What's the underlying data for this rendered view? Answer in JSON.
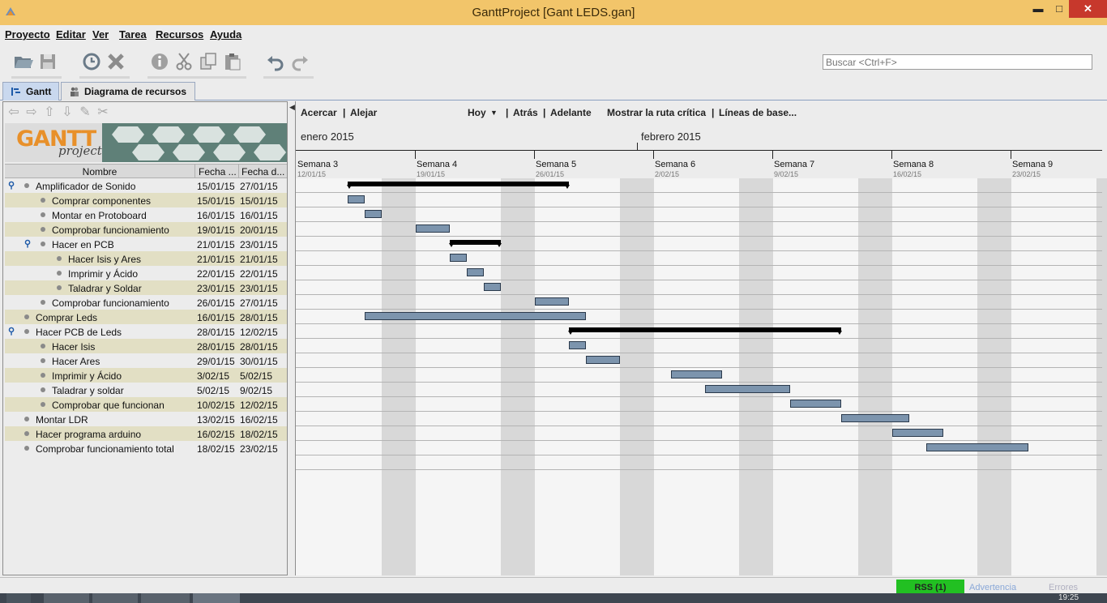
{
  "window": {
    "title": "GanttProject [Gant LEDS.gan]",
    "minimize": "▬",
    "maximize": "□",
    "close": "✕"
  },
  "menu": [
    "Proyecto",
    "Editar",
    "Ver",
    "Tarea",
    "Recursos",
    "Ayuda"
  ],
  "toolbar": {
    "icons": [
      "open-folder-icon",
      "save-icon",
      "history-icon",
      "delete-icon",
      "info-icon",
      "cut-icon",
      "copy-icon",
      "paste-icon",
      "undo-icon",
      "redo-icon"
    ],
    "search_placeholder": "Buscar <Ctrl+F>"
  },
  "tabs": {
    "gantt": "Gantt",
    "resources": "Diagrama de recursos"
  },
  "logo": {
    "text": "GANTT",
    "sub": "project"
  },
  "table": {
    "headers": {
      "name": "Nombre",
      "start": "Fecha ...",
      "end": "Fecha d..."
    },
    "rows": [
      {
        "name": "Amplificador de Sonido",
        "start": "15/01/15",
        "end": "27/01/15"
      },
      {
        "name": "Comprar componentes",
        "start": "15/01/15",
        "end": "15/01/15"
      },
      {
        "name": "Montar en Protoboard",
        "start": "16/01/15",
        "end": "16/01/15"
      },
      {
        "name": "Comprobar funcionamiento",
        "start": "19/01/15",
        "end": "20/01/15"
      },
      {
        "name": "Hacer en PCB",
        "start": "21/01/15",
        "end": "23/01/15"
      },
      {
        "name": "Hacer Isis y Ares",
        "start": "21/01/15",
        "end": "21/01/15"
      },
      {
        "name": "Imprimir y Ácido",
        "start": "22/01/15",
        "end": "22/01/15"
      },
      {
        "name": "Taladrar y Soldar",
        "start": "23/01/15",
        "end": "23/01/15"
      },
      {
        "name": "Comprobar funcionamiento",
        "start": "26/01/15",
        "end": "27/01/15"
      },
      {
        "name": "Comprar Leds",
        "start": "16/01/15",
        "end": "28/01/15"
      },
      {
        "name": "Hacer PCB de Leds",
        "start": "28/01/15",
        "end": "12/02/15"
      },
      {
        "name": "Hacer Isis",
        "start": "28/01/15",
        "end": "28/01/15"
      },
      {
        "name": "Hacer Ares",
        "start": "29/01/15",
        "end": "30/01/15"
      },
      {
        "name": "Imprimir y Ácido",
        "start": "3/02/15",
        "end": "5/02/15"
      },
      {
        "name": "Taladrar y soldar",
        "start": "5/02/15",
        "end": "9/02/15"
      },
      {
        "name": "Comprobar que funcionan",
        "start": "10/02/15",
        "end": "12/02/15"
      },
      {
        "name": "Montar LDR",
        "start": "13/02/15",
        "end": "16/02/15"
      },
      {
        "name": "Hacer programa arduino",
        "start": "16/02/15",
        "end": "18/02/15"
      },
      {
        "name": "Comprobar funcionamiento total",
        "start": "18/02/15",
        "end": "23/02/15"
      }
    ]
  },
  "chart_nav": {
    "zoom_in": "Acercar",
    "zoom_out": "Alejar",
    "today": "Hoy",
    "back": "Atrás",
    "forward": "Adelante",
    "critical_path": "Mostrar la ruta crítica",
    "baselines": "Líneas de base...",
    "sep": "|"
  },
  "timeline": {
    "months": [
      "enero 2015",
      "febrero 2015"
    ],
    "weeks": [
      {
        "label": "Semana 3",
        "date": "12/01/15"
      },
      {
        "label": "Semana 4",
        "date": "19/01/15"
      },
      {
        "label": "Semana 5",
        "date": "26/01/15"
      },
      {
        "label": "Semana 6",
        "date": "2/02/15"
      },
      {
        "label": "Semana 7",
        "date": "9/02/15"
      },
      {
        "label": "Semana 8",
        "date": "16/02/15"
      },
      {
        "label": "Semana 9",
        "date": "23/02/15"
      }
    ]
  },
  "status": {
    "rss": "RSS (1)",
    "warnings": "Advertencia",
    "errors": "Errores"
  },
  "taskbar": {
    "clock": "19:25"
  },
  "colors": {
    "titlebar": "#f2c56a",
    "bar_fill": "#7c94ad",
    "row_alt": "#e2dfc4",
    "rss": "#22c022"
  }
}
